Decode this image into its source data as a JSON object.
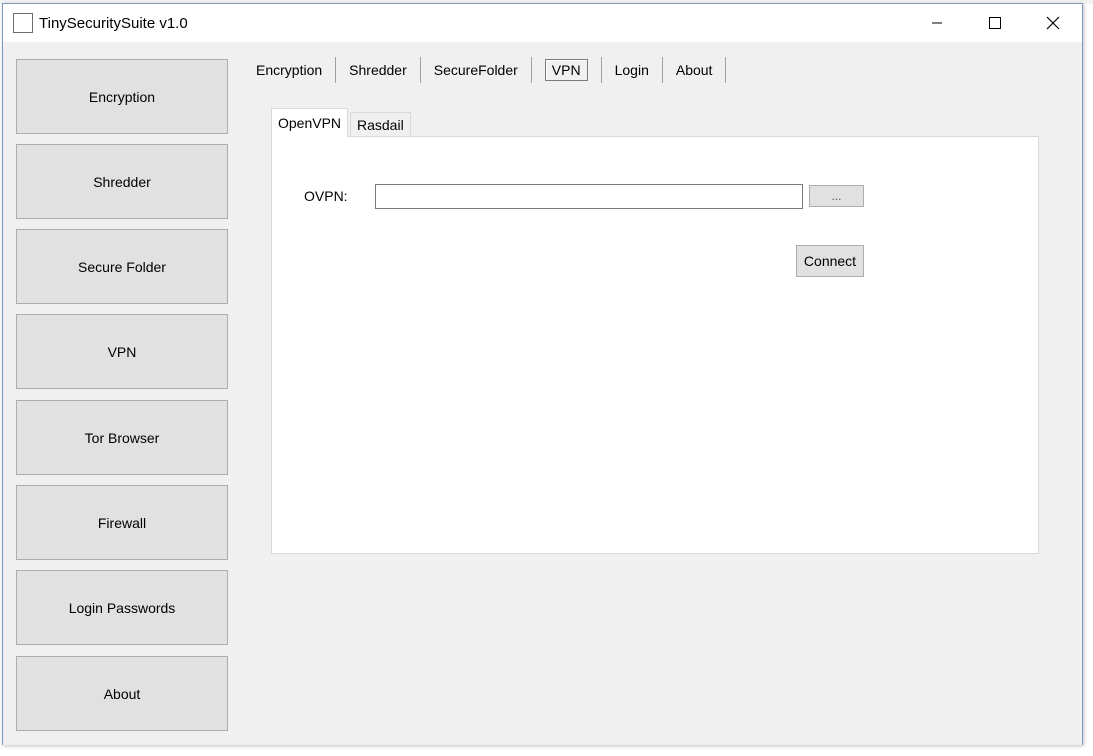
{
  "window": {
    "title": "TinySecuritySuite v1.0",
    "minimize_icon": "minimize-icon",
    "maximize_icon": "maximize-icon",
    "close_icon": "close-icon"
  },
  "sidebar": {
    "items": [
      {
        "label": "Encryption"
      },
      {
        "label": "Shredder"
      },
      {
        "label": "Secure Folder"
      },
      {
        "label": "VPN"
      },
      {
        "label": "Tor Browser"
      },
      {
        "label": "Firewall"
      },
      {
        "label": "Login Passwords"
      },
      {
        "label": "About"
      }
    ]
  },
  "top_tabs": {
    "items": [
      {
        "label": "Encryption"
      },
      {
        "label": "Shredder"
      },
      {
        "label": "SecureFolder"
      },
      {
        "label": "VPN"
      },
      {
        "label": "Login"
      },
      {
        "label": "About"
      }
    ],
    "active": "VPN"
  },
  "vpn": {
    "tabs": [
      {
        "label": "OpenVPN"
      },
      {
        "label": "Rasdail"
      }
    ],
    "active_tab": "OpenVPN",
    "ovpn_label": "OVPN:",
    "ovpn_value": "",
    "browse_label": "...",
    "connect_label": "Connect"
  },
  "colors": {
    "window_bg": "#f0f0f0",
    "button_bg": "#e1e1e1",
    "button_border": "#adadad",
    "panel_bg": "#ffffff"
  }
}
